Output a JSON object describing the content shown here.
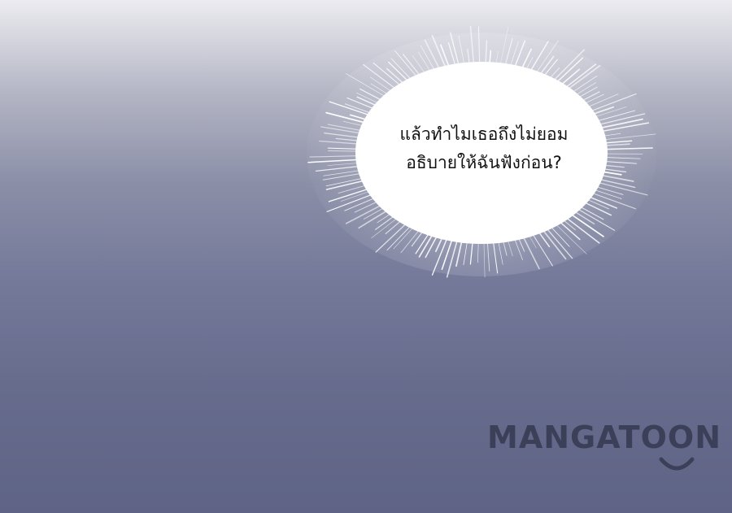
{
  "speech_bubble": {
    "line1": "แล้วทำไมเธอถึงไม่ยอม",
    "line2": "อธิบายให้ฉันฟังก่อน?"
  },
  "watermark": {
    "text": "MANGATOON"
  },
  "colors": {
    "background_top": "#ececf0",
    "background_bottom": "#5f6486",
    "bubble_fill": "#ffffff",
    "text": "#111111",
    "watermark": "#3b4058"
  }
}
